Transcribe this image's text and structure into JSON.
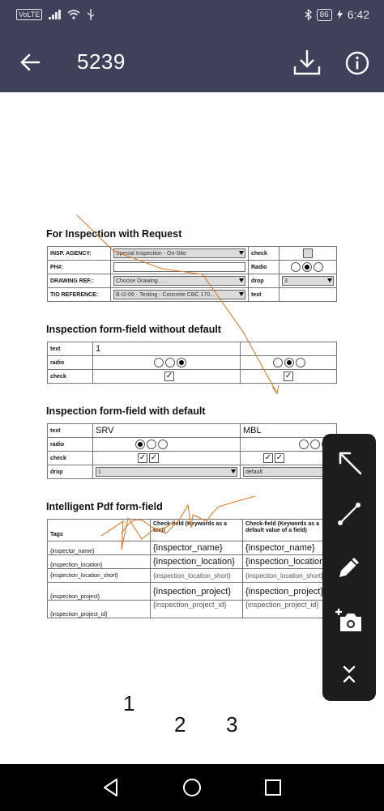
{
  "status_bar": {
    "network": "VoLTE",
    "battery": "86",
    "time": "6:42"
  },
  "app_bar": {
    "title": "5239"
  },
  "icons": {
    "back": "arrow-left-icon",
    "download": "download-icon",
    "info": "info-icon",
    "select": "select-arrow-icon",
    "line": "line-tool-icon",
    "pen": "pen-icon",
    "camera": "add-photo-icon",
    "collapse": "collapse-icon"
  },
  "section1": {
    "title": "For Inspection  with Request",
    "rows": [
      {
        "label": "INSP. AGENCY:",
        "value": "Special Inspection - On-Site",
        "right_label": "check"
      },
      {
        "label": "PH#:",
        "value": "",
        "right_label": "Radio"
      },
      {
        "label": "DRAWING REF.:",
        "value": "Choose Drawing . . .",
        "right_label": "drop",
        "right_value": "3"
      },
      {
        "label": "TIO REFERENCE:",
        "value": "B-I2-06 - Testing - Concrete  CBC  170...",
        "right_label": "text"
      }
    ]
  },
  "section2": {
    "title": "Inspection form-field without default",
    "rows": [
      {
        "label": "text",
        "left_value": "1"
      },
      {
        "label": "radio"
      },
      {
        "label": "check"
      }
    ]
  },
  "section3": {
    "title": "Inspection form-field with default",
    "rows": [
      {
        "label": "text",
        "left_value": "SRV",
        "right_value": "MBL"
      },
      {
        "label": "radio"
      },
      {
        "label": "check"
      },
      {
        "label": "drop",
        "left_value": "1",
        "right_value": "default"
      }
    ]
  },
  "section4": {
    "title": "Intelligent Pdf  form-field",
    "headers": {
      "tags": "Tags",
      "col1": "Check-field (Keywords as a text)",
      "col2": "Check-field (Keywords  as a default value of a field)"
    },
    "rows": [
      {
        "tag": "{inspector_name}",
        "col1": "{inspector_name}",
        "col2": "{inspector_name}"
      },
      {
        "tag": "{inspection_location}",
        "col1": "{inspection_location}",
        "col2": "{inspection_location}"
      },
      {
        "tag": "{inspection_location_short}",
        "col1": "{inspection_location_short}",
        "col2": "{inspection_location_short}"
      },
      {
        "tag": "{inspection_project}",
        "col1": "{inspection_project}",
        "col2": "{inspection_project}"
      },
      {
        "tag": "{inspection_project_id}",
        "col1": "{inspection_project_id}",
        "col2": "{inspection_project_id}"
      }
    ]
  },
  "page_numbers": [
    "1",
    "2",
    "3"
  ],
  "colors": {
    "app_bar": "#3e4159",
    "toolbar": "#1d1d1f",
    "ink": "#e07b2a"
  }
}
